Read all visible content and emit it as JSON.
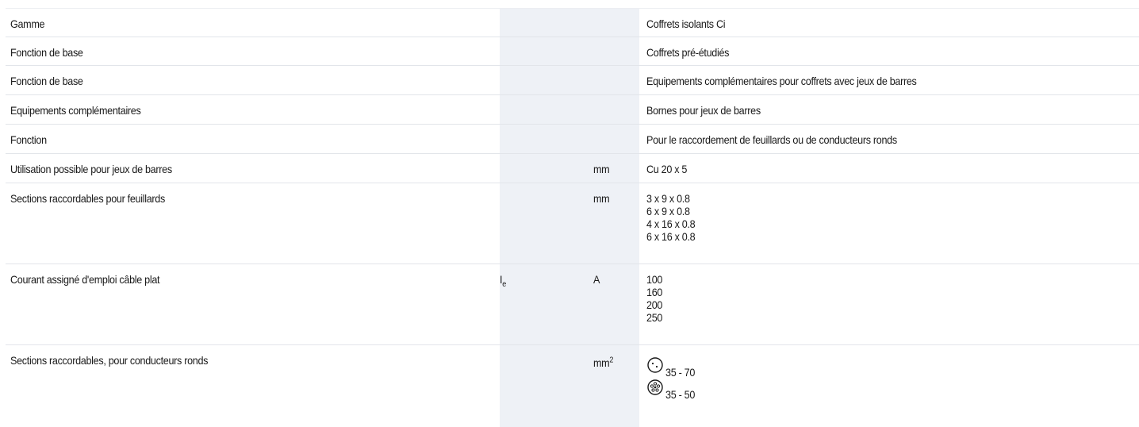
{
  "rows": [
    {
      "label": "Gamme",
      "symbol": "",
      "symbol_sub": "",
      "unit": "",
      "unit_sup": "",
      "values": [
        "Coffrets isolants Ci"
      ]
    },
    {
      "label": "Fonction de base",
      "symbol": "",
      "symbol_sub": "",
      "unit": "",
      "unit_sup": "",
      "values": [
        "Coffrets pré-étudiés"
      ]
    },
    {
      "label": "Fonction de base",
      "symbol": "",
      "symbol_sub": "",
      "unit": "",
      "unit_sup": "",
      "values": [
        "Equipements complémentaires pour coffrets avec jeux de barres"
      ]
    },
    {
      "label": "Equipements complémentaires",
      "symbol": "",
      "symbol_sub": "",
      "unit": "",
      "unit_sup": "",
      "values": [
        "Bornes pour jeux de barres"
      ]
    },
    {
      "label": "Fonction",
      "symbol": "",
      "symbol_sub": "",
      "unit": "",
      "unit_sup": "",
      "values": [
        "Pour le raccordement de feuillards ou de conducteurs ronds"
      ]
    },
    {
      "label": "Utilisation possible pour jeux de barres",
      "symbol": "",
      "symbol_sub": "",
      "unit": "mm",
      "unit_sup": "",
      "values": [
        "Cu 20 x 5"
      ]
    },
    {
      "label": "Sections raccordables pour feuillards",
      "symbol": "",
      "symbol_sub": "",
      "unit": "mm",
      "unit_sup": "",
      "values": [
        "3 x 9 x 0.8",
        "6 x 9 x 0.8",
        "4 x 16 x 0.8",
        "6 x 16 x 0.8"
      ]
    },
    {
      "label": "Courant assigné d'emploi câble plat",
      "symbol": "I",
      "symbol_sub": "e",
      "unit": "A",
      "unit_sup": "",
      "values": [
        "100",
        "160",
        "200",
        "250"
      ]
    },
    {
      "label": "Sections raccordables, pour conducteurs ronds",
      "symbol": "",
      "symbol_sub": "",
      "unit": "mm",
      "unit_sup": "2",
      "values": []
    }
  ],
  "round_conductors": [
    {
      "icon": "solid-conductor-icon",
      "range": "35 - 70"
    },
    {
      "icon": "stranded-conductor-icon",
      "range": "35 - 50"
    }
  ],
  "colors": {
    "shade": "#eef1f6",
    "rule": "#e2e5ea",
    "text": "#1a1a1a"
  }
}
